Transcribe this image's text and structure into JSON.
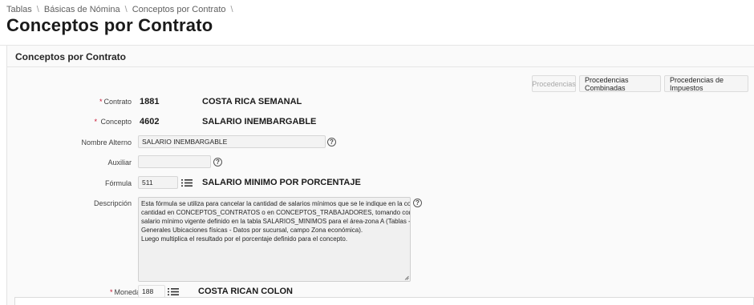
{
  "breadcrumb": {
    "items": [
      "Tablas",
      "Básicas de Nómina",
      "Conceptos por Contrato"
    ],
    "separator": "\\"
  },
  "page": {
    "title": "Conceptos por Contrato"
  },
  "region": {
    "title": "Conceptos por Contrato"
  },
  "buttons": {
    "procedencias": "Procedencias",
    "combinadas": "Procedencias Combinadas",
    "impuestos": "Procedencias de Impuestos"
  },
  "form": {
    "required_mark": "*",
    "contrato": {
      "label": "Contrato",
      "code": "1881",
      "name": "COSTA RICA SEMANAL"
    },
    "concepto": {
      "label": "Concepto",
      "code": "4602",
      "name": "SALARIO INEMBARGABLE"
    },
    "nombre_alterno": {
      "label": "Nombre Alterno",
      "value": "SALARIO INEMBARGABLE"
    },
    "auxiliar": {
      "label": "Auxiliar",
      "value": ""
    },
    "formula": {
      "label": "Fórmula",
      "code": "511",
      "name": "SALARIO MINIMO POR PORCENTAJE"
    },
    "descripcion": {
      "label": "Descripción",
      "lines": [
        "Esta fórmula se utiliza para cancelar la cantidad de salarios mínimos que se le indique en la columna",
        "cantidad en CONCEPTOS_CONTRATOS o en CONCEPTOS_TRABAJADORES, tomando como base el",
        "salario mínimo vigente definido en la tabla SALARIOS_MINIMOS para el área-zona A (Tablas -",
        "Generales Ubicaciones físicas - Datos por sucursal, campo Zona económica).",
        "Luego multiplica el resultado por el porcentaje definido para el concepto."
      ]
    },
    "moneda": {
      "label": "Moneda",
      "code": "188",
      "name": "COSTA RICAN COLON"
    },
    "help_glyph": "?"
  },
  "icons": {
    "help": "question-circle-icon",
    "lov": "list-icon"
  }
}
